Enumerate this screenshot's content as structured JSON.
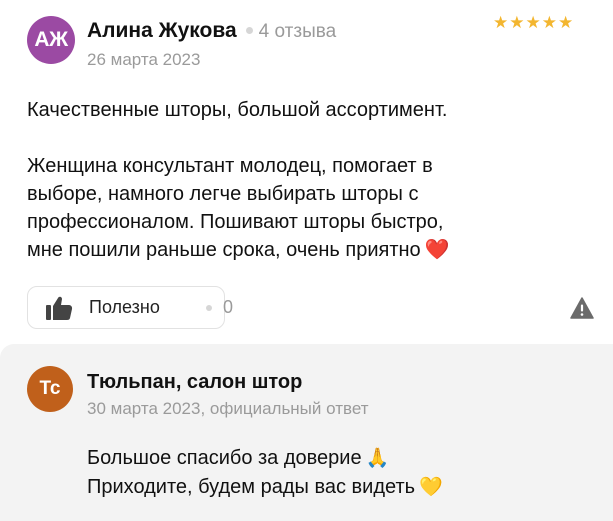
{
  "review": {
    "avatar_initials": "АЖ",
    "avatar_color": "#9b4aa3",
    "author_name": "Алина Жукова",
    "review_count": "4 отзыва",
    "date": "26 марта 2023",
    "rating": 5,
    "rating_max": 5,
    "star_color": "#f3b630",
    "text": {
      "paragraph1": "Качественные шторы, большой ассортимент.",
      "paragraph2_lines": [
        "Женщина консультант молодец, помогает в",
        "выборе, намного легче выбирать шторы с",
        "профессионалом. Пошивают шторы быстро,",
        "мне пошили раньше срока, очень приятно"
      ],
      "end_emoji": "❤️"
    },
    "helpful": {
      "label": "Полезно",
      "count": "0"
    }
  },
  "reply": {
    "avatar_initials": "Тс",
    "avatar_color": "#c0601b",
    "author_name": "Тюльпан, салон штор",
    "meta": "30 марта 2023, официальный ответ",
    "lines": [
      {
        "text": "Большое спасибо за доверие",
        "emoji": "🙏"
      },
      {
        "text": "Приходите, будем рады вас видеть",
        "emoji": "💛"
      }
    ]
  }
}
